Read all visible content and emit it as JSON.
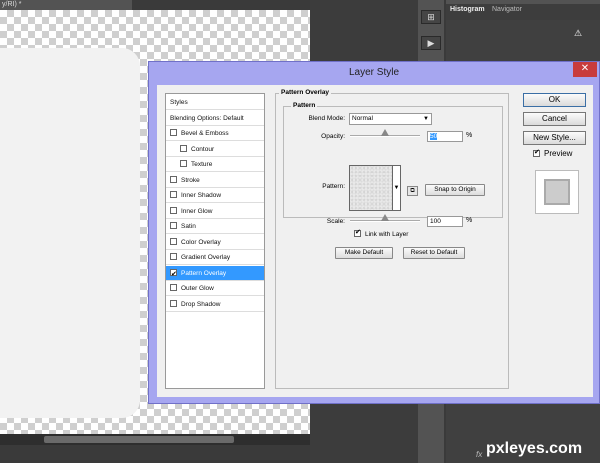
{
  "app": {
    "document_tab": "y/RI) *",
    "panel_tabs": [
      "Histogram",
      "Navigator"
    ],
    "watermark": "pxleyes.com",
    "status_fx": "fx"
  },
  "dialog": {
    "title": "Layer Style",
    "close_icon": "close-icon",
    "styles_list": [
      {
        "label": "Styles",
        "checkbox": false,
        "checked": false,
        "indent": false,
        "selected": false
      },
      {
        "label": "Blending Options: Default",
        "checkbox": false,
        "checked": false,
        "indent": false,
        "selected": false
      },
      {
        "label": "Bevel & Emboss",
        "checkbox": true,
        "checked": false,
        "indent": false,
        "selected": false
      },
      {
        "label": "Contour",
        "checkbox": true,
        "checked": false,
        "indent": true,
        "selected": false
      },
      {
        "label": "Texture",
        "checkbox": true,
        "checked": false,
        "indent": true,
        "selected": false
      },
      {
        "label": "Stroke",
        "checkbox": true,
        "checked": false,
        "indent": false,
        "selected": false
      },
      {
        "label": "Inner Shadow",
        "checkbox": true,
        "checked": false,
        "indent": false,
        "selected": false
      },
      {
        "label": "Inner Glow",
        "checkbox": true,
        "checked": false,
        "indent": false,
        "selected": false
      },
      {
        "label": "Satin",
        "checkbox": true,
        "checked": false,
        "indent": false,
        "selected": false
      },
      {
        "label": "Color Overlay",
        "checkbox": true,
        "checked": false,
        "indent": false,
        "selected": false
      },
      {
        "label": "Gradient Overlay",
        "checkbox": true,
        "checked": false,
        "indent": false,
        "selected": false
      },
      {
        "label": "Pattern Overlay",
        "checkbox": true,
        "checked": true,
        "indent": false,
        "selected": true
      },
      {
        "label": "Outer Glow",
        "checkbox": true,
        "checked": false,
        "indent": false,
        "selected": false
      },
      {
        "label": "Drop Shadow",
        "checkbox": true,
        "checked": false,
        "indent": false,
        "selected": false
      }
    ],
    "pattern_overlay": {
      "group_title": "Pattern Overlay",
      "subgroup_title": "Pattern",
      "blend_mode_label": "Blend Mode:",
      "blend_mode_value": "Normal",
      "opacity_label": "Opacity:",
      "opacity_value": "50",
      "opacity_unit": "%",
      "opacity_fraction": 0.5,
      "pattern_label": "Pattern:",
      "snap_to_origin": "Snap to Origin",
      "scale_label": "Scale:",
      "scale_value": "100",
      "scale_unit": "%",
      "scale_fraction": 0.5,
      "link_with_layer": "Link with Layer",
      "link_checked": true,
      "make_default": "Make Default",
      "reset_to_default": "Reset to Default"
    },
    "buttons": {
      "ok": "OK",
      "cancel": "Cancel",
      "new_style": "New Style..."
    },
    "preview_label": "Preview",
    "preview_checked": true
  },
  "colors": {
    "dialog_frame": "#a6a6f0",
    "selection": "#3399ff",
    "close_button": "#c83c3c"
  }
}
